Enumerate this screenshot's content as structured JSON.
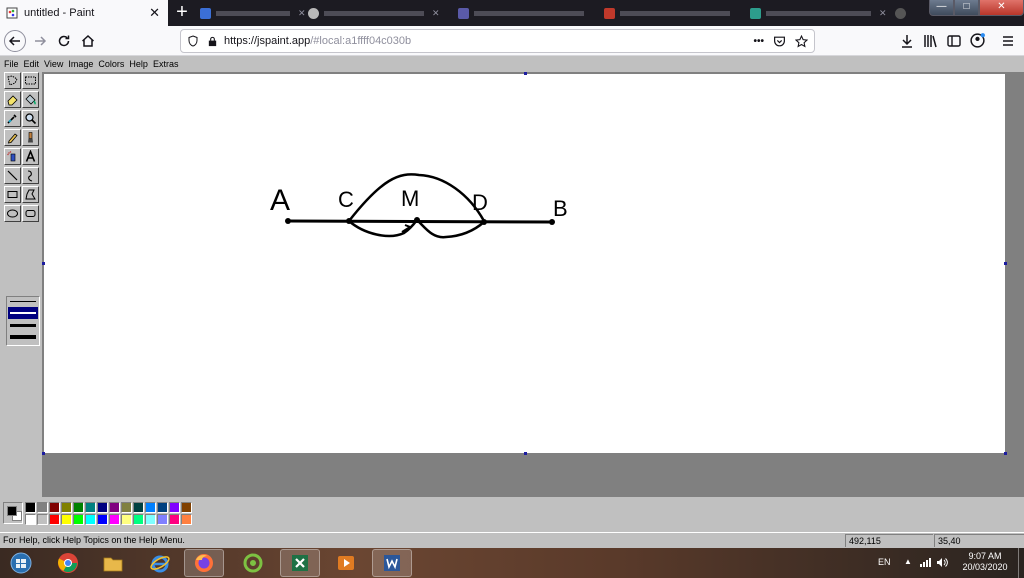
{
  "browser": {
    "active_tab": {
      "title": "untitled - Paint",
      "close": "✕"
    },
    "new_tab": "+",
    "background_tab_count": 6,
    "window_controls": {
      "minimize": "—",
      "maximize": "□",
      "close": "✕"
    },
    "url": {
      "host": "https://jspaint.app",
      "rest": "/#local:a1ffff04c030b"
    },
    "url_actions": {
      "more": "•••"
    }
  },
  "paint": {
    "menu": [
      "File",
      "Edit",
      "View",
      "Image",
      "Colors",
      "Help",
      "Extras"
    ],
    "tools": [
      "free-form-select",
      "select",
      "eraser",
      "fill",
      "pick-color",
      "magnifier",
      "pencil",
      "brush",
      "airbrush",
      "text",
      "line",
      "curve",
      "rectangle",
      "polygon",
      "ellipse",
      "rounded-rectangle"
    ],
    "drawing": {
      "labels": {
        "a": "A",
        "c": "C",
        "m": "M",
        "d": "D",
        "b": "B"
      }
    },
    "colors": {
      "foreground": "#000000",
      "background": "#ffffff",
      "palette_top": [
        "#000000",
        "#808080",
        "#800000",
        "#808000",
        "#008000",
        "#008080",
        "#000080",
        "#800080",
        "#808040",
        "#004040",
        "#0080ff",
        "#004080",
        "#8000ff",
        "#804000"
      ],
      "palette_bottom": [
        "#ffffff",
        "#c0c0c0",
        "#ff0000",
        "#ffff00",
        "#00ff00",
        "#00ffff",
        "#0000ff",
        "#ff00ff",
        "#ffff80",
        "#00ff80",
        "#80ffff",
        "#8080ff",
        "#ff0080",
        "#ff8040"
      ]
    },
    "status": {
      "help": "For Help, click Help Topics on the Help Menu.",
      "cursor_position": "492,115",
      "selection_size": "35,40"
    }
  },
  "taskbar": {
    "apps": [
      "start",
      "chrome",
      "file-explorer",
      "internet-explorer",
      "firefox",
      "app-green",
      "excel",
      "media-player",
      "word"
    ],
    "tray": {
      "language": "EN",
      "time": "9:07 AM",
      "date": "20/03/2020"
    }
  }
}
